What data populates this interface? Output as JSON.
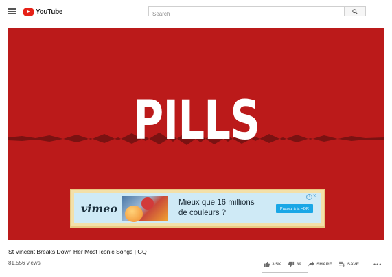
{
  "header": {
    "logo_text": "YouTube",
    "search_placeholder": "Search"
  },
  "player": {
    "overlay_title": "PILLS",
    "ad": {
      "brand": "vimeo",
      "headline_line1": "Mieux que 16 millions",
      "headline_line2": "de couleurs ?",
      "cta_label": "Passez à la HDR",
      "close_label": "X"
    }
  },
  "video": {
    "title": "St Vincent Breaks Down Her Most Iconic Songs | GQ",
    "views": "81,556 views",
    "likes": "3.5K",
    "dislikes": "39",
    "share_label": "SHARE",
    "save_label": "SAVE",
    "more_label": "•••"
  },
  "colors": {
    "player_background": "#bb1a1a",
    "youtube_red": "#e62117",
    "ad_background": "#cfeaf6",
    "ad_border": "#f3e0a9",
    "cta_blue": "#1aa7e6"
  }
}
